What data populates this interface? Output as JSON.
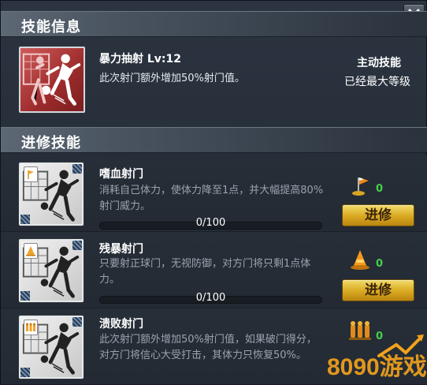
{
  "window": {
    "close_icon": "close-icon"
  },
  "skill_info": {
    "header": "技能信息",
    "current": {
      "name": "暴力抽射 Lv:12",
      "description": "此次射门额外增加50%射门值。",
      "type": "主动技能",
      "status": "已经最大等级",
      "icon": "soccer-shot-icon"
    }
  },
  "advanced": {
    "header": "进修技能",
    "skills": [
      {
        "name": "嗜血射门",
        "description": "消耗自己体力，使体力降至1点，并大幅提高80%射门威力。",
        "progress_text": "0/100",
        "progress": 0,
        "cost_icon": "corner-flag-icon",
        "cost": "0",
        "button": "进修",
        "badge_icon": "flag-badge-icon"
      },
      {
        "name": "残暴射门",
        "description": "只要射正球门，无视防御，对方门将只剩1点体力。",
        "progress_text": "0/100",
        "progress": 0,
        "cost_icon": "training-cone-icon",
        "cost": "0",
        "button": "进修",
        "badge_icon": "cone-badge-icon"
      },
      {
        "name": "溃败射门",
        "description": "此次射门额外增加50%射门值，如果破门得分，对方门将信心大受打击，其体力只恢复50%。",
        "progress_text": "",
        "progress": 0,
        "cost_icon": "training-dummies-icon",
        "cost": "0",
        "button": "",
        "badge_icon": "dummies-badge-icon"
      }
    ]
  },
  "watermark": {
    "text": "8090游戏"
  },
  "colors": {
    "accent_gold": "#d9a820",
    "count_green": "#45d04a",
    "icon_red": "#9c2b2c"
  }
}
